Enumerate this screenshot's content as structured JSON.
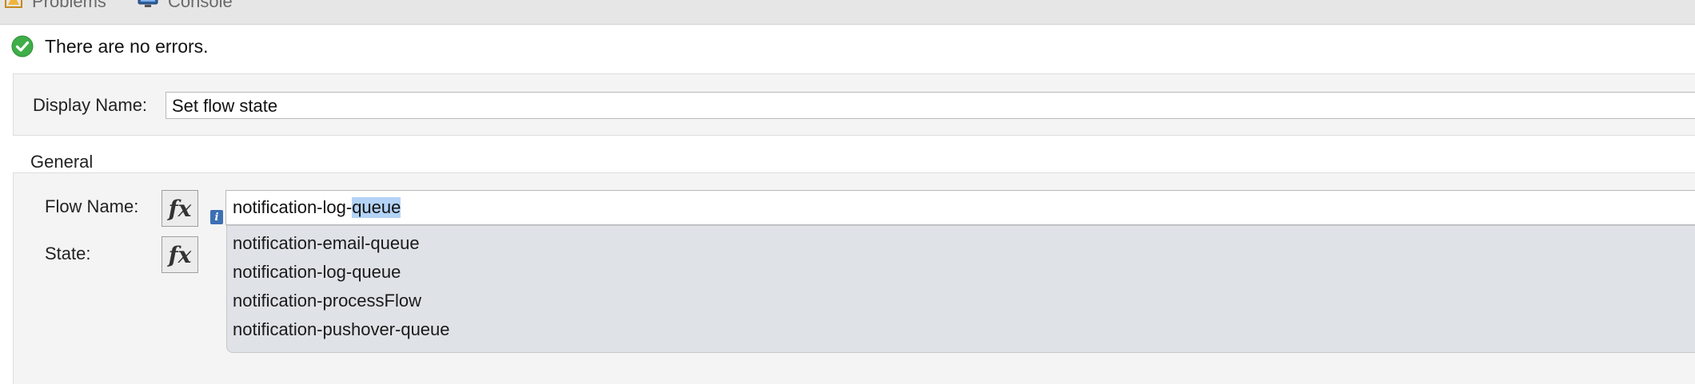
{
  "tabs": [
    {
      "label": "Problems",
      "icon": "problems-icon"
    },
    {
      "label": "Console",
      "icon": "console-icon"
    }
  ],
  "status": {
    "icon": "check-circle-icon",
    "text": "There are no errors.",
    "color": "#4caf50"
  },
  "display": {
    "label": "Display Name:",
    "value": "Set flow state"
  },
  "general": {
    "title": "General",
    "flow_name_label": "Flow Name:",
    "flow_name_value_prefix": "notification-log-",
    "flow_name_value_selected": "queue",
    "state_label": "State:",
    "fx_label": "fx",
    "info_icon": "i"
  },
  "autocomplete": {
    "items": [
      "notification-email-queue",
      "notification-log-queue",
      "notification-processFlow",
      "notification-pushover-queue"
    ]
  },
  "colors": {
    "selection": "#b3d3f7",
    "dropdown_bg": "#dfe2e6",
    "panel_bg": "#f4f4f4"
  }
}
